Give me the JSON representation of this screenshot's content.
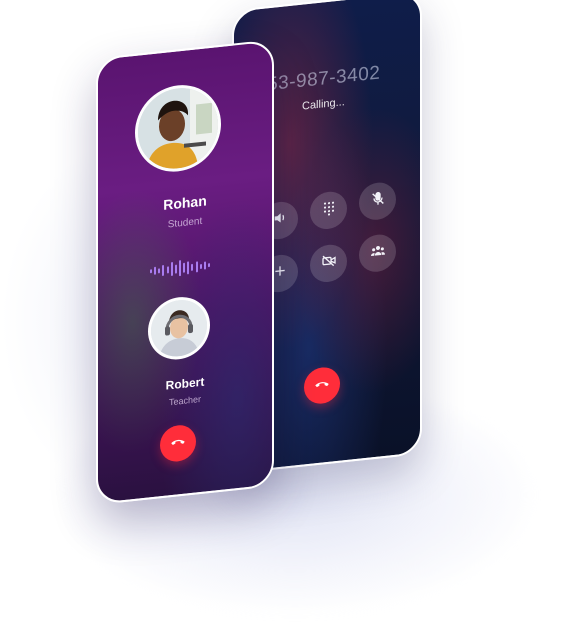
{
  "back_phone": {
    "phone_number": "553-987-3402",
    "status": "Calling...",
    "controls": [
      {
        "name": "speaker-icon"
      },
      {
        "name": "keypad-icon"
      },
      {
        "name": "mute-icon"
      },
      {
        "name": "add-call-icon"
      },
      {
        "name": "video-off-icon"
      },
      {
        "name": "group-icon"
      }
    ],
    "end_call_icon": "end-call-icon"
  },
  "front_phone": {
    "caller": {
      "name": "Rohan",
      "role": "Student"
    },
    "callee": {
      "name": "Robert",
      "role": "Teacher"
    },
    "end_call_icon": "end-call-icon"
  },
  "colors": {
    "end_call": "#ff2d3a",
    "waveform": "#a97cf0",
    "front_bg": "#5a1470",
    "back_bg": "#0f1d4a"
  }
}
